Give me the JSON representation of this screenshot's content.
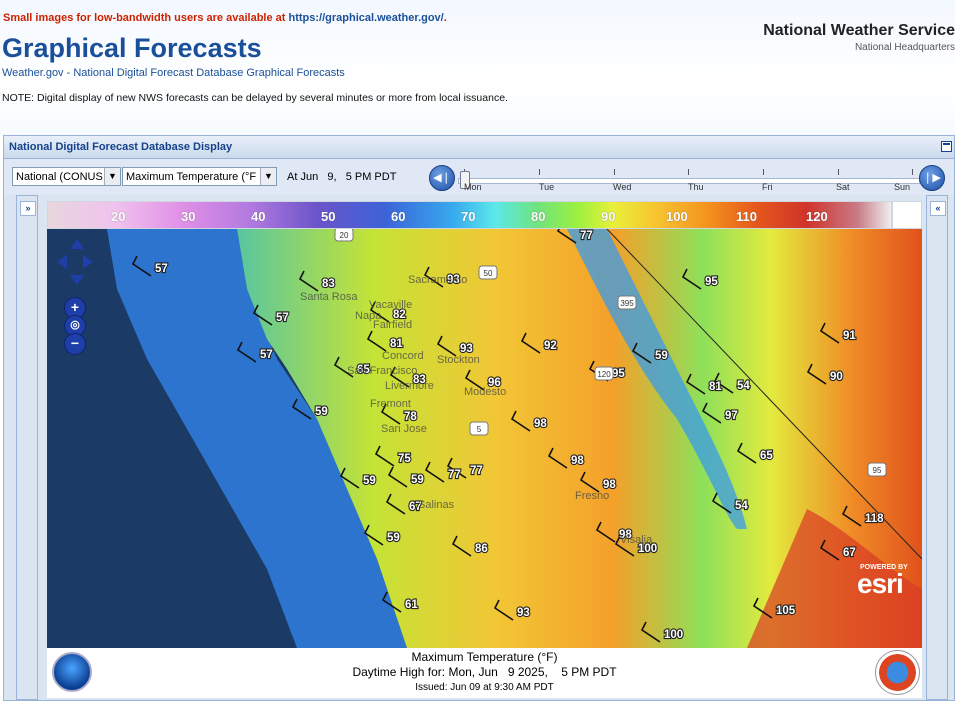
{
  "header": {
    "small_note_prefix": "Small images for low-bandwidth users are available at ",
    "small_note_link": "https://graphical.weather.gov/",
    "small_note_suffix": ".",
    "site_title": "Graphical Forecasts",
    "breadcrumb_home": "Weather.gov",
    "breadcrumb_sep": " - ",
    "breadcrumb_current": "National Digital Forecast Database Graphical Forecasts",
    "note": "NOTE: Digital display of new NWS forecasts can be delayed by several minutes or more from local issuance.",
    "agency": "National Weather Service",
    "agency_sub": "National Headquarters"
  },
  "panel": {
    "title": "National Digital Forecast Database Display",
    "region_select": "National (CONUS",
    "element_select": "Maximum Temperature (°F",
    "time_label": "At Jun   9,   5 PM PDT",
    "slider_days": [
      "Mon",
      "Tue",
      "Wed",
      "Thu",
      "Fri",
      "Sat",
      "Sun"
    ]
  },
  "legend": {
    "values": [
      "20",
      "30",
      "40",
      "50",
      "60",
      "70",
      "80",
      "90",
      "100",
      "110",
      "120"
    ]
  },
  "map": {
    "temps": [
      "57",
      "83",
      "57",
      "82",
      "57",
      "81",
      "93",
      "92",
      "95",
      "91",
      "93",
      "65",
      "83",
      "96",
      "59",
      "77",
      "81",
      "54",
      "59",
      "78",
      "98",
      "97",
      "90",
      "75",
      "98",
      "65",
      "59",
      "77",
      "59",
      "98",
      "67",
      "54",
      "59",
      "86",
      "98",
      "100",
      "118",
      "67",
      "61",
      "93",
      "105",
      "100",
      "77",
      "95"
    ],
    "highways": [
      "20",
      "50",
      "395",
      "120",
      "5",
      "95"
    ],
    "cities": [
      "Sacramento",
      "Santa Rosa",
      "Vacaville",
      "Napa",
      "Fairfield",
      "Concord",
      "Stockton",
      "San Francisco",
      "Livermore",
      "Modesto",
      "Fremont",
      "San Jose",
      "Salinas",
      "Fresno",
      "Visalia"
    ],
    "esri_powered": "POWERED BY",
    "esri": "esri",
    "colors": {
      "ocean": "#1b3a66",
      "coast": "#2f7fe0",
      "hot": "#e0521c"
    }
  },
  "footer": {
    "product": "Maximum Temperature (°F)",
    "valid": "Daytime High for: Mon, Jun   9 2025,    5 PM PDT",
    "issued": "Issued: Jun 09 at 9:30 AM PDT"
  }
}
